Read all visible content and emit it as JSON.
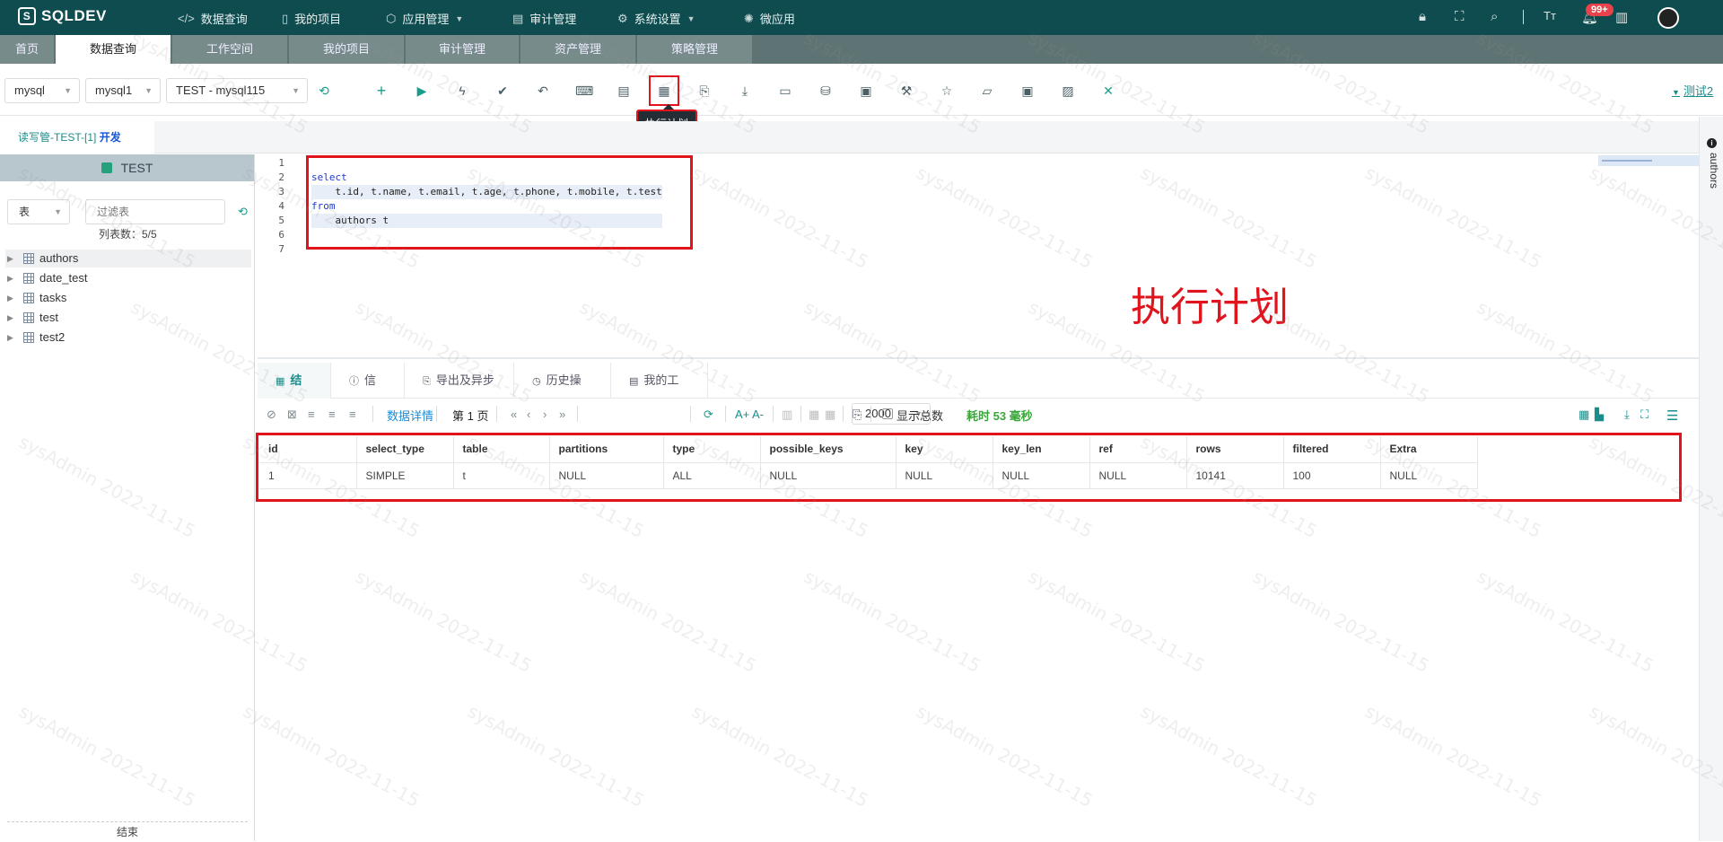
{
  "app": {
    "logo": "SQLDEV"
  },
  "topnav": {
    "items": [
      {
        "label": "数据查询",
        "icon": "</>"
      },
      {
        "label": "我的项目",
        "icon": "▯"
      },
      {
        "label": "应用管理",
        "icon": "⬡"
      },
      {
        "label": "审计管理",
        "icon": "▤"
      },
      {
        "label": "系统设置",
        "icon": "⚙"
      },
      {
        "label": "微应用",
        "icon": "✺"
      }
    ],
    "badge": "99+"
  },
  "tabs": [
    "首页",
    "数据查询",
    "工作空间",
    "我的项目",
    "审计管理",
    "资产管理",
    "策略管理"
  ],
  "toolbar": {
    "db_type": "mysql",
    "instance": "mysql1",
    "connection": "TEST - mysql115",
    "tooltip": "执行计划",
    "user": "测试2"
  },
  "subtab": {
    "label": "读写管-TEST-[1]",
    "mode": "开发"
  },
  "left": {
    "db_name": "TEST",
    "filter_type": "表",
    "filter_placeholder": "过滤表",
    "count_text": "列表数：5/5",
    "tables": [
      "authors",
      "date_test",
      "tasks",
      "test",
      "test2"
    ],
    "footer": "结束"
  },
  "editor": {
    "line_numbers": [
      "1",
      "2",
      "3",
      "4",
      "5",
      "6",
      "7"
    ],
    "lines": [
      "",
      "select",
      "    t.id, t.name, t.email, t.age, t.phone, t.mobile, t.test",
      "from",
      "    authors t",
      "",
      ""
    ],
    "annotation": "执行计划"
  },
  "result_tabs": [
    "结果",
    "信息",
    "导出及异步",
    "历史操作",
    "我的工单"
  ],
  "result_tools": {
    "detail_label": "数据详情",
    "page_label": "第 1 页",
    "page_size": "2000",
    "show_total_label": "显示总数",
    "elapsed": "耗时 53 毫秒"
  },
  "result": {
    "columns": [
      "id",
      "select_type",
      "table",
      "partitions",
      "type",
      "possible_keys",
      "key",
      "key_len",
      "ref",
      "rows",
      "filtered",
      "Extra"
    ],
    "rows": [
      [
        "1",
        "SIMPLE",
        "t",
        "NULL",
        "ALL",
        "NULL",
        "NULL",
        "NULL",
        "NULL",
        "10141",
        "100",
        "NULL"
      ]
    ]
  },
  "right_panel": {
    "label": "authors"
  },
  "watermark": "sysAdmin 2022-11-15",
  "colors": {
    "topbar": "#0f4c4f",
    "accent": "#1a8c8a",
    "highlight": "#e1141d"
  }
}
